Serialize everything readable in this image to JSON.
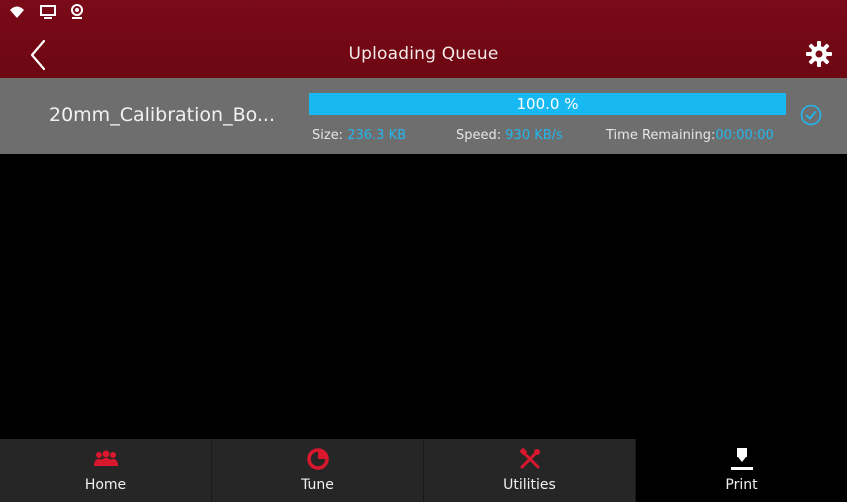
{
  "header": {
    "title": "Uploading Queue",
    "background": "#7a0a18"
  },
  "queue": [
    {
      "file_name": "20mm_Calibration_Bo...",
      "progress": 100.0,
      "progress_text": "100.0 %",
      "size_label": "Size:",
      "size_value": "236.3 KB",
      "speed_label": "Speed:",
      "speed_value": "930 KB/s",
      "time_label": "Time Remaining:",
      "time_value": "00:00:00",
      "status_icon": "check-circle-icon"
    }
  ],
  "nav": {
    "active": "print",
    "items": [
      {
        "id": "home",
        "label": "Home",
        "icon": "group-icon"
      },
      {
        "id": "tune",
        "label": "Tune",
        "icon": "pie-chart-icon"
      },
      {
        "id": "utilities",
        "label": "Utilities",
        "icon": "tools-icon"
      },
      {
        "id": "print",
        "label": "Print",
        "icon": "print-nozzle-icon"
      }
    ]
  },
  "colors": {
    "accent": "#18b9f2",
    "brand": "#7a0a18",
    "nav_icon_red": "#d9182e"
  }
}
